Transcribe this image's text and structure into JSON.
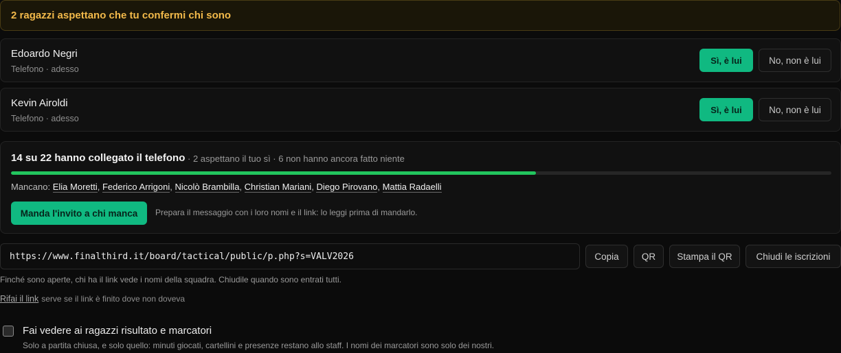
{
  "banner": {
    "text": "2 ragazzi aspettano che tu confermi chi sono"
  },
  "pending": [
    {
      "name": "Edoardo Negri",
      "meta": "Telefono · adesso",
      "yes_label": "Sì, è lui",
      "no_label": "No, non è lui"
    },
    {
      "name": "Kevin Airoldi",
      "meta": "Telefono · adesso",
      "yes_label": "Sì, è lui",
      "no_label": "No, non è lui"
    }
  ],
  "progress": {
    "title": "14 su 22 hanno collegato il telefono",
    "subtitle": "· 2 aspettano il tuo sì · 6 non hanno ancora fatto niente",
    "fraction": 0.64,
    "bar_color": "#22c55e",
    "missing_label": "Mancano:",
    "missing_names": [
      "Elia Moretti",
      "Federico Arrigoni",
      "Nicolò Brambilla",
      "Christian Mariani",
      "Diego Pirovano",
      "Mattia Radaelli"
    ],
    "invite_label": "Manda l'invito a chi manca",
    "invite_hint": "Prepara il messaggio con i loro nomi e il link: lo leggi prima di mandarlo."
  },
  "link": {
    "url": "https://www.finalthird.it/board/tactical/public/p.php?s=VALV2026",
    "copy_label": "Copia",
    "qr_label": "QR",
    "print_qr_label": "Stampa il QR",
    "close_label": "Chiudi le iscrizioni",
    "note": "Finché sono aperte, chi ha il link vede i nomi della squadra. Chiudile quando sono entrati tutti.",
    "redo_label": "Rifai il link",
    "redo_hint": "serve se il link è finito dove non doveva"
  },
  "results": {
    "checked": false,
    "label": "Fai vedere ai ragazzi risultato e marcatori",
    "hint": "Solo a partita chiusa, e solo quello: minuti giocati, cartellini e presenze restano allo staff. I nomi dei marcatori sono solo dei nostri."
  },
  "colors": {
    "accent": "#10b981",
    "warning": "#f2b94a"
  }
}
